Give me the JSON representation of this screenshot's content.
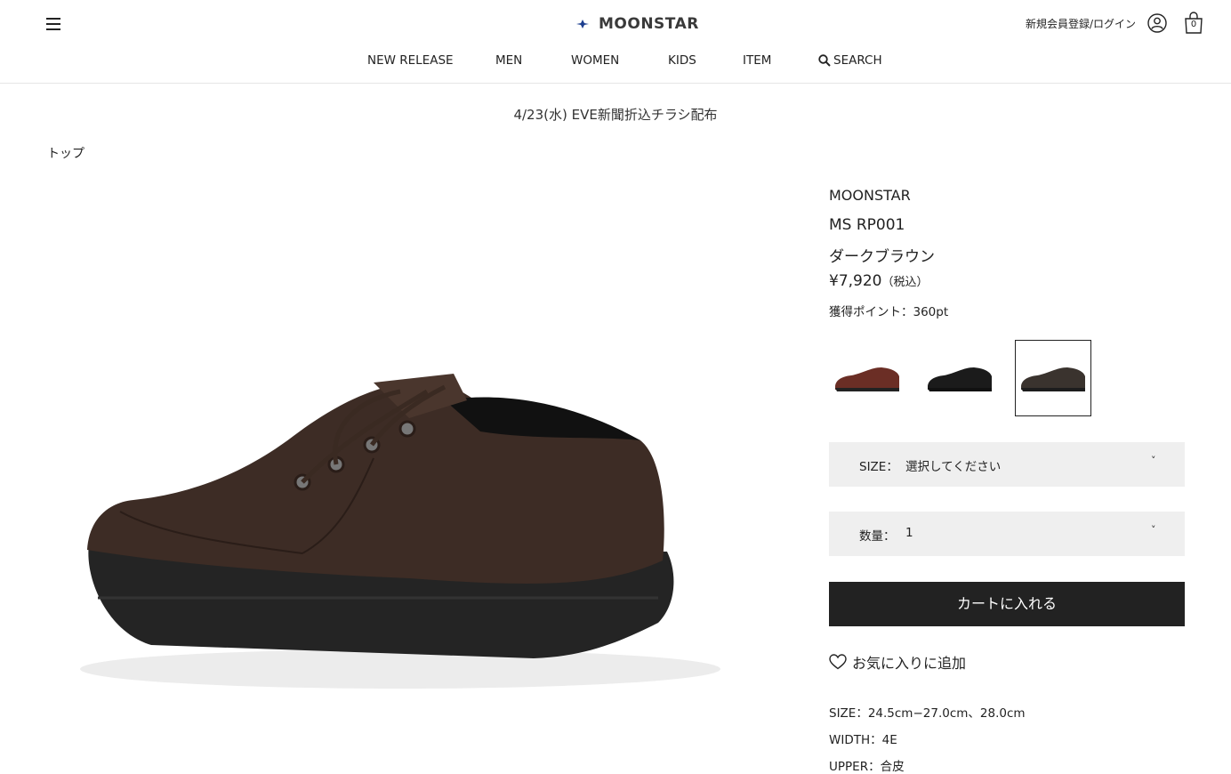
{
  "header": {
    "logo_text": "MOONSTAR",
    "account_link": "新規会員登録/ログイン",
    "cart_count": "0"
  },
  "nav": {
    "items": [
      "NEW RELEASE",
      "MEN",
      "WOMEN",
      "KIDS",
      "ITEM"
    ],
    "search_label": "SEARCH"
  },
  "notice": "4/23(水) EVE新聞折込チラシ配布",
  "breadcrumb": "トップ",
  "product": {
    "brand": "MOONSTAR",
    "model": "MS RP001",
    "color_name": "ダークブラウン",
    "price": "¥7,920",
    "price_tax": "（税込）",
    "points": "獲得ポイント：360pt",
    "swatch_colors": [
      "#6b2e25",
      "#1b1b1b",
      "#3a332e"
    ],
    "main_color": "#3d2c25"
  },
  "selectors": {
    "size_label": "SIZE：",
    "size_value": "選択してください",
    "qty_label": "数量：",
    "qty_value": "1",
    "caret": "˅"
  },
  "actions": {
    "add_to_cart": "カートに入れる",
    "favorite": "お気に入りに追加"
  },
  "specs": {
    "size": "SIZE：24.5cm−27.0cm、28.0cm",
    "width": "WIDTH：4E",
    "upper": "UPPER：合皮"
  }
}
